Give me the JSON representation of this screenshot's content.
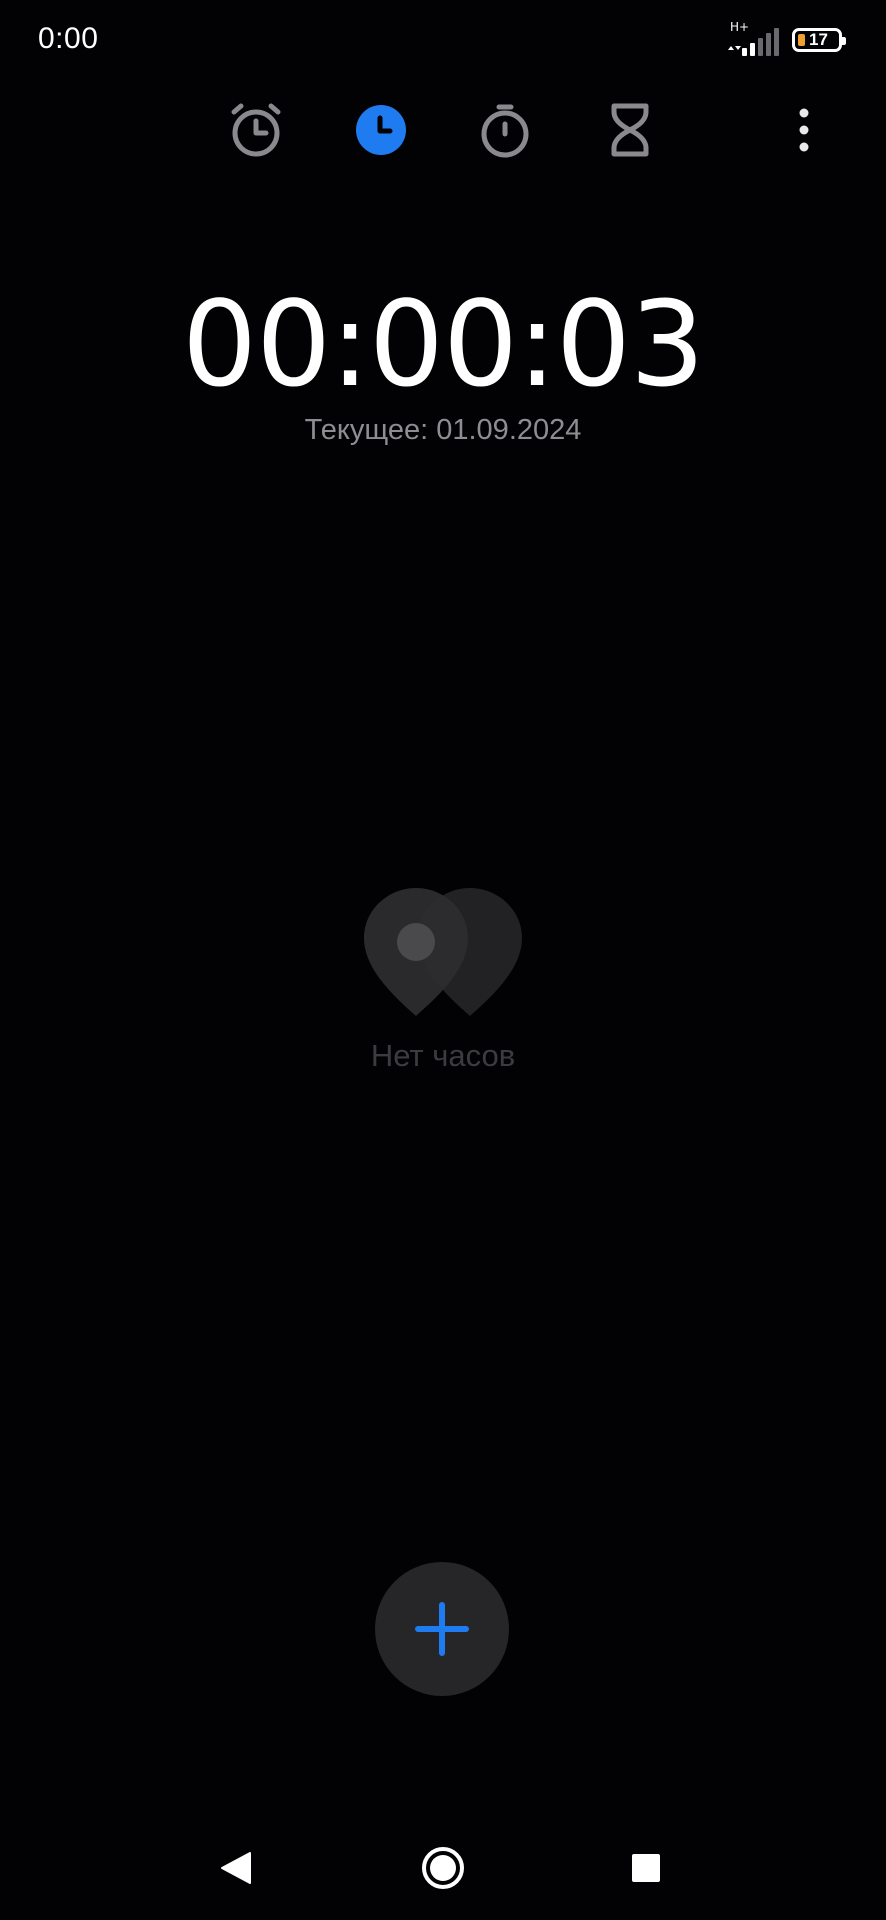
{
  "status_bar": {
    "time": "0:00",
    "network_type": "H+",
    "battery_level": "17"
  },
  "tabs": [
    {
      "icon": "alarm-clock-icon",
      "active": false
    },
    {
      "icon": "world-clock-icon",
      "active": true
    },
    {
      "icon": "stopwatch-icon",
      "active": false
    },
    {
      "icon": "timer-hourglass-icon",
      "active": false
    }
  ],
  "clock": {
    "time": "00:00:03",
    "date_label": "Текущее: 01.09.2024"
  },
  "empty_state": {
    "text": "Нет часов",
    "icon": "location-pins-icon"
  },
  "fab": {
    "icon": "plus-icon"
  },
  "colors": {
    "background": "#020103",
    "accent": "#1e7cf0",
    "inactive_icon": "#8a8a8e",
    "fab_background": "#262628",
    "battery_fill": "#f0a030"
  },
  "nav_bar": [
    "back-icon",
    "home-icon",
    "recents-icon"
  ]
}
